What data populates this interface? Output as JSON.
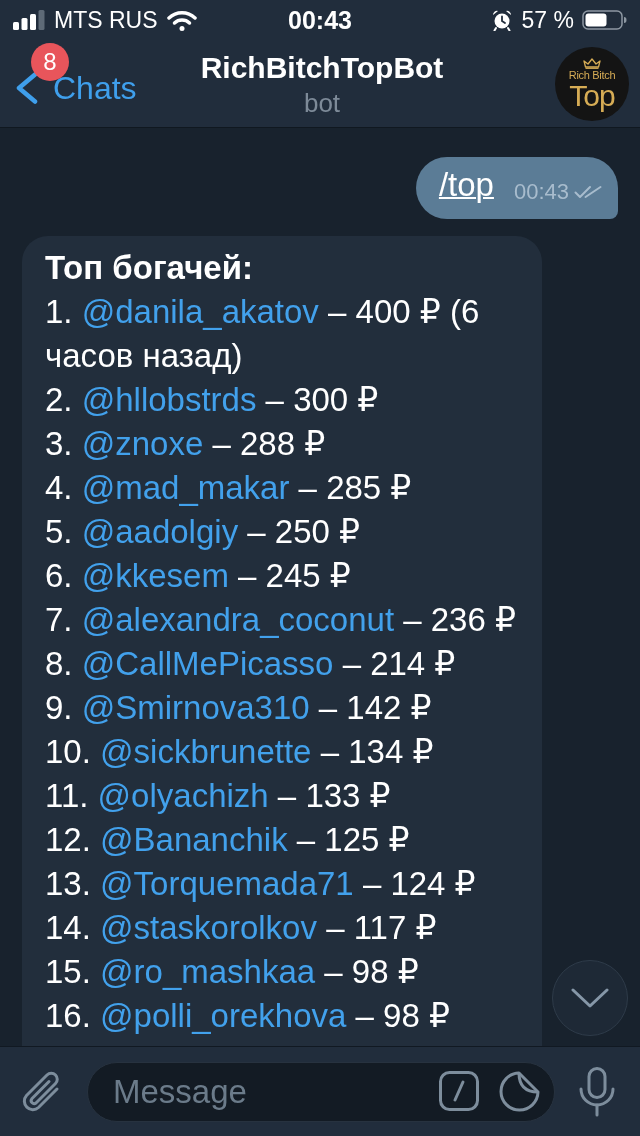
{
  "status_bar": {
    "carrier": "MTS RUS",
    "time": "00:43",
    "battery": "57 %"
  },
  "header": {
    "back_label": "Chats",
    "unread_badge": "8",
    "title": "RichBitchTopBot",
    "subtitle": "bot",
    "avatar": {
      "line_1": "Rich Bitch",
      "line_2": "Top"
    }
  },
  "messages": [
    {
      "kind": "outgoing",
      "text": "/top",
      "time": "00:43",
      "read": true
    },
    {
      "kind": "incoming",
      "title": "Топ богачей:",
      "items": [
        {
          "rank": "1.",
          "username": "@danila_akatov",
          "detail": "– 400 ₽ (6 часов назад)"
        },
        {
          "rank": "2.",
          "username": "@hllobstrds",
          "detail": "– 300 ₽"
        },
        {
          "rank": "3.",
          "username": "@znoxe",
          "detail": "– 288 ₽"
        },
        {
          "rank": "4.",
          "username": "@mad_makar",
          "detail": "– 285 ₽"
        },
        {
          "rank": "5.",
          "username": "@aadolgiy",
          "detail": "– 250 ₽"
        },
        {
          "rank": "6.",
          "username": "@kkesem",
          "detail": "– 245 ₽"
        },
        {
          "rank": "7.",
          "username": "@alexandra_coconut",
          "detail": "– 236 ₽"
        },
        {
          "rank": "8.",
          "username": "@CallMePicasso",
          "detail": "– 214 ₽"
        },
        {
          "rank": "9.",
          "username": "@Smirnova310",
          "detail": "– 142 ₽"
        },
        {
          "rank": "10.",
          "username": "@sickbrunette",
          "detail": "– 134 ₽"
        },
        {
          "rank": "11.",
          "username": "@olyachizh",
          "detail": "– 133 ₽"
        },
        {
          "rank": "12.",
          "username": "@Bananchik",
          "detail": "– 125 ₽"
        },
        {
          "rank": "13.",
          "username": "@Torquemada71",
          "detail": "– 124 ₽"
        },
        {
          "rank": "14.",
          "username": "@staskorolkov",
          "detail": "– 117 ₽"
        },
        {
          "rank": "15.",
          "username": "@ro_mashkaa",
          "detail": "– 98 ₽"
        },
        {
          "rank": "16.",
          "username": "@polli_orekhova",
          "detail": "– 98 ₽"
        }
      ]
    }
  ],
  "composer": {
    "placeholder": "Message"
  }
}
